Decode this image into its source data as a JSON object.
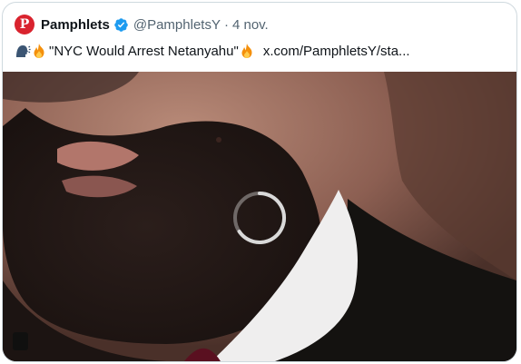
{
  "tweet": {
    "author_name": "Pamphlets",
    "author_handle": "@PamphletsY",
    "separator": "·",
    "date": "4 nov.",
    "avatar_letter": "P",
    "quote_text": "\"NYC Would Arrest Netanyahu\"",
    "link_text": "x.com/PamphletsY/sta..."
  },
  "icons": {
    "avatar": "pamphlets-logo-icon",
    "verified": "verified-badge-icon",
    "speaking_head": "speaking-head-emoji-icon",
    "fire": "fire-emoji-icon",
    "spinner": "loading-spinner-icon"
  },
  "colors": {
    "avatar_bg": "#d9232e",
    "verified": "#1d9bf0",
    "secondary_text": "#536471",
    "border": "#cfd9de"
  }
}
